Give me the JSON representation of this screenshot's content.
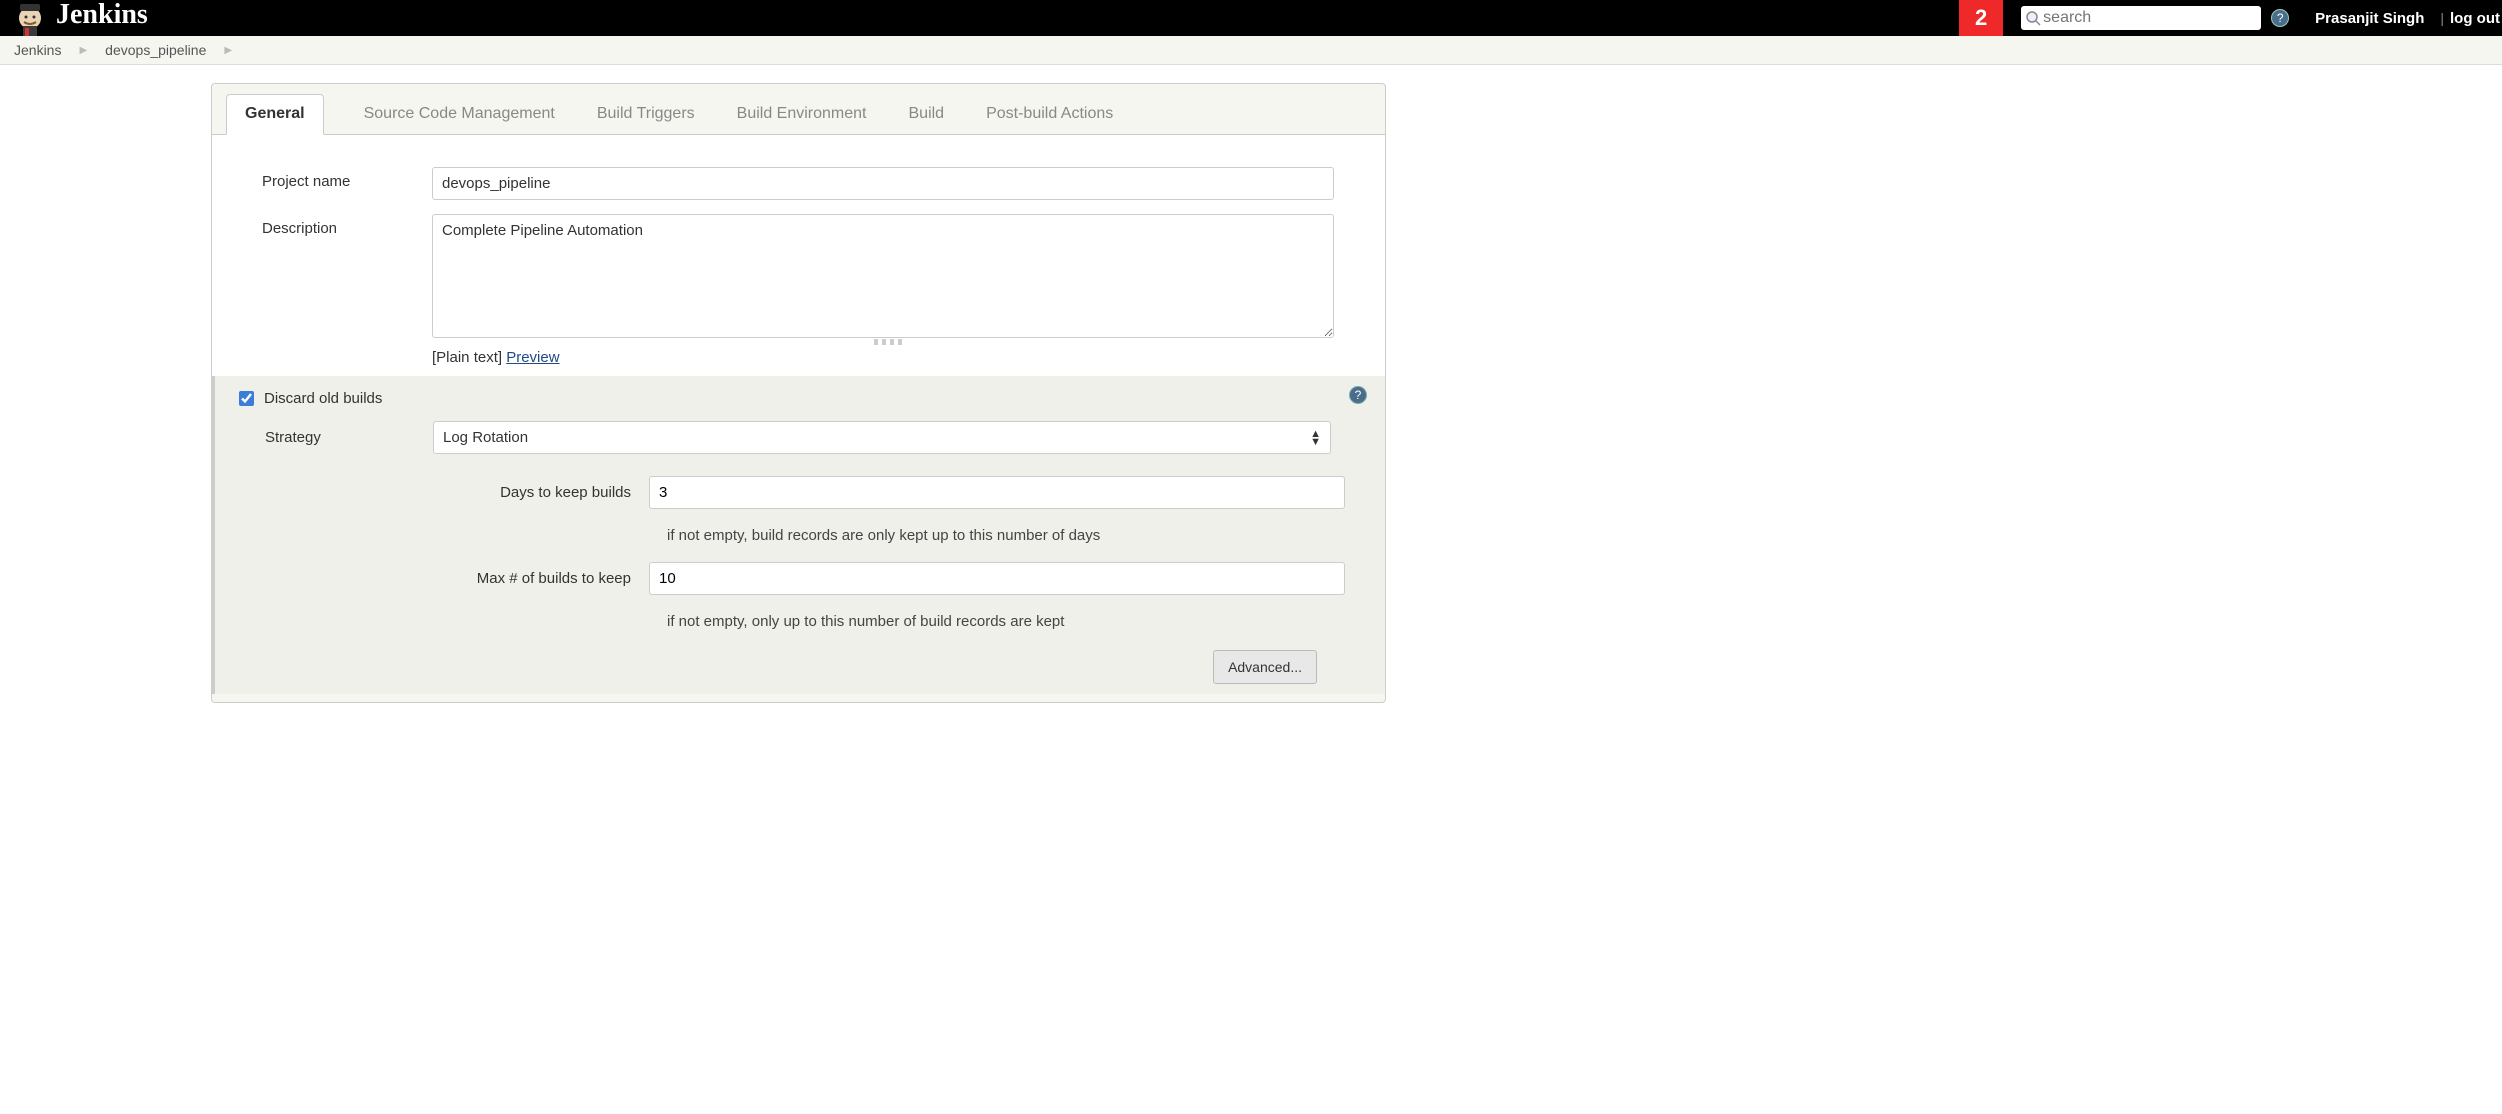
{
  "header": {
    "brand": "Jenkins",
    "notif_count": "2",
    "search_placeholder": "search",
    "username": "Prasanjit Singh",
    "logout": "log out"
  },
  "breadcrumb": {
    "items": [
      "Jenkins",
      "devops_pipeline"
    ]
  },
  "tabs": [
    "General",
    "Source Code Management",
    "Build Triggers",
    "Build Environment",
    "Build",
    "Post-build Actions"
  ],
  "form": {
    "project_name_label": "Project name",
    "project_name_value": "devops_pipeline",
    "description_label": "Description",
    "description_value": "Complete Pipeline Automation",
    "plain_text": "[Plain text]",
    "preview": "Preview",
    "discard_label": "Discard old builds",
    "discard_checked": true,
    "strategy_label": "Strategy",
    "strategy_value": "Log Rotation",
    "days_label": "Days to keep builds",
    "days_value": "3",
    "days_hint": "if not empty, build records are only kept up to this number of days",
    "max_label": "Max # of builds to keep",
    "max_value": "10",
    "max_hint": "if not empty, only up to this number of build records are kept",
    "advanced": "Advanced..."
  }
}
